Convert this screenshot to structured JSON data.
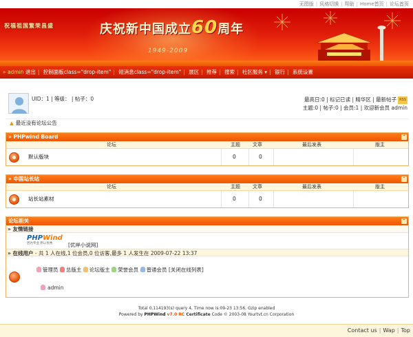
{
  "toplinks": [
    "无图版",
    "风格切换",
    "帮助",
    "Home首页",
    "论坛首页"
  ],
  "banner": {
    "slogan": "祝福祖国繁荣昌盛",
    "headline_prefix": "庆祝新中国成立",
    "headline_num": "60",
    "headline_suffix": "周年",
    "years": "1949-2009"
  },
  "nav": {
    "user": "admin",
    "items": [
      "退出",
      "控制面板class=\"drop-item\"",
      "短消息class=\"drop-item\"",
      "展区",
      "推荐",
      "搜索",
      "社区服务",
      "银行",
      "系统设置"
    ]
  },
  "user": {
    "info": "UID：1 | 等级： | 帖子：0",
    "right_line1": "最高日:0 | 标记已读 | 精华区 | 最新帖子",
    "right_badge": "RSS",
    "right_line2": "主题:0 | 帖子:0 | 会员:1 | 欢迎新会员 admin"
  },
  "notice": "最近没有论坛公告",
  "columns": {
    "forum": "论坛",
    "topics": "主题",
    "posts": "文章",
    "last": "最后发表",
    "mod": "版主"
  },
  "sections": [
    {
      "title": "» PHPwind Board",
      "forum": "默认版块",
      "topics": "0",
      "posts": "0"
    },
    {
      "title": "» 中国站长站",
      "forum": "站长站素材",
      "topics": "0",
      "posts": "0"
    }
  ],
  "related": {
    "title": "论坛相关",
    "links_label": "» 友情链接",
    "logo_text": "PHPWind",
    "logo_tag": "因为专业 所以优秀",
    "link_text": "[优岸小说网]",
    "online_label": "» 在线用户",
    "online_text": " - 共 1 人在线,1 位会员,0 位访客,最多 1 人发生在 2009-07-22 13:37",
    "legend": [
      {
        "label": "管理员",
        "color": "#f6a0b8"
      },
      {
        "label": "总版主",
        "color": "#f08080"
      },
      {
        "label": "论坛版主",
        "color": "#f2c070"
      },
      {
        "label": "荣誉会员",
        "color": "#9ed28a"
      },
      {
        "label": "普通会员",
        "color": "#9ab8e0"
      }
    ],
    "close_online": "[关闭在线列表]",
    "online_user": "admin"
  },
  "footer": {
    "line1": "Total 0.114193(s) query 4, Time now is:09-23 13:56, Gzip enabled",
    "line2_a": "Powered by ",
    "line2_pw": "PHPWind",
    "line2_ver": " v7.0 RC",
    "line2_b": " Certificate",
    "line2_c": " Code © 2003-08 Yourtvt.cn Corporation"
  },
  "bottombar": [
    "Contact us",
    "Wap",
    "Top"
  ]
}
